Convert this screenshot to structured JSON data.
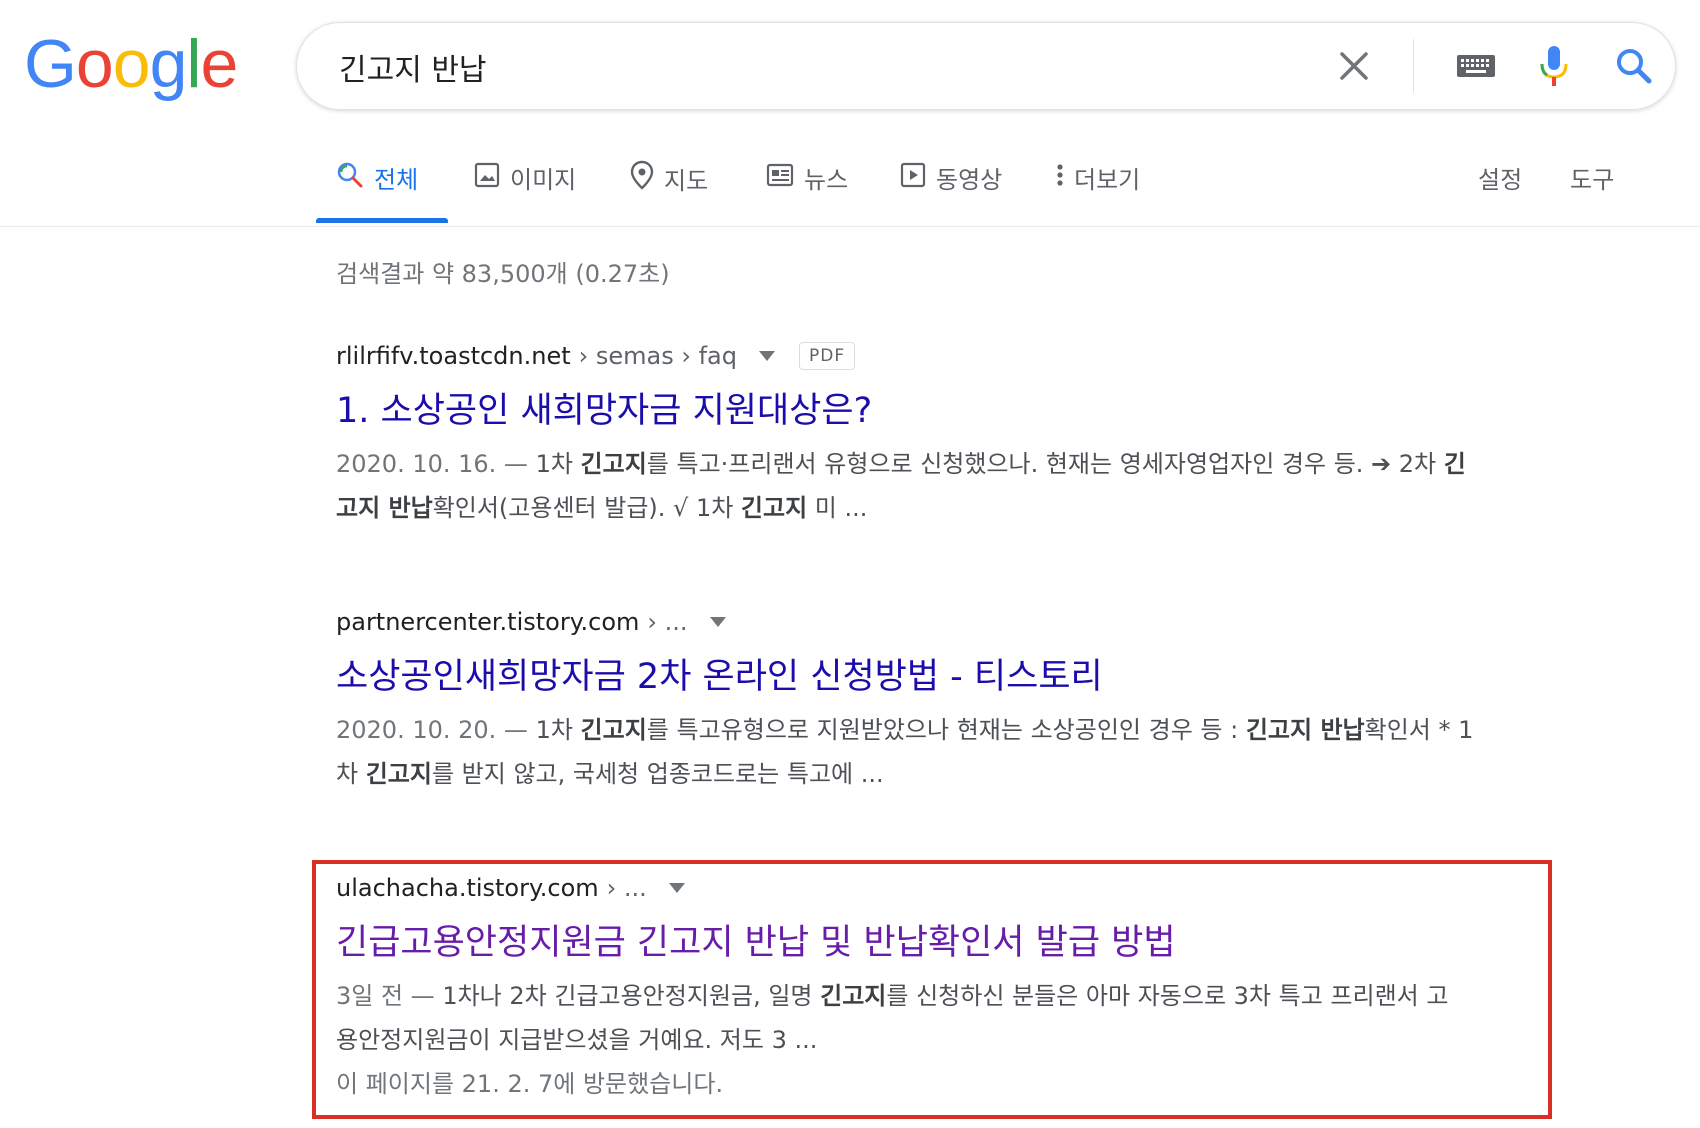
{
  "logo": {
    "letters": [
      "G",
      "o",
      "o",
      "g",
      "l",
      "e"
    ],
    "colors": [
      "#4285F4",
      "#EA4335",
      "#FBBC05",
      "#4285F4",
      "#34A853",
      "#EA4335"
    ]
  },
  "search": {
    "query": "긴고지 반납"
  },
  "icons": {
    "clear": "close-icon",
    "keyboard": "keyboard-icon",
    "voice": "microphone-icon",
    "search": "search-icon"
  },
  "tabs": [
    {
      "label": "전체",
      "icon": "search-icon",
      "active": true
    },
    {
      "label": "이미지",
      "icon": "image-icon"
    },
    {
      "label": "지도",
      "icon": "map-pin-icon"
    },
    {
      "label": "뉴스",
      "icon": "news-icon"
    },
    {
      "label": "동영상",
      "icon": "video-icon"
    },
    {
      "label": "더보기",
      "icon": "more-vert-icon"
    }
  ],
  "tools": {
    "settings": "설정",
    "tools": "도구"
  },
  "stats": "검색결과 약 83,500개 (0.27초)",
  "colors": {
    "link": "#1a0dab",
    "visited": "#681da8",
    "accent": "#1a73e8",
    "highlight": "#d93025"
  },
  "results": [
    {
      "domain": "rlilrfifv.toastcdn.net",
      "path": " › semas › faq",
      "badge": "PDF",
      "title": "1. 소상공인 새희망자금 지원대상은?",
      "date": "2020. 10. 16. — ",
      "snippet_line1": [
        {
          "t": "1차 "
        },
        {
          "t": "긴고지",
          "b": true
        },
        {
          "t": "를 특고·프리랜서 유형으로 신청했으나. 현재는 영세자영업자인 경우 등. ➔ 2차 "
        },
        {
          "t": "긴",
          "b": true
        }
      ],
      "snippet_line2": [
        {
          "t": "고지 반납",
          "b": true
        },
        {
          "t": "확인서(고용센터 발급). √ 1차 "
        },
        {
          "t": "긴고지",
          "b": true
        },
        {
          "t": " 미 ..."
        }
      ]
    },
    {
      "domain": "partnercenter.tistory.com",
      "path": " › ...",
      "title": "소상공인새희망자금 2차 온라인 신청방법 - 티스토리",
      "date": "2020. 10. 20. — ",
      "snippet_line1": [
        {
          "t": "1차 "
        },
        {
          "t": "긴고지",
          "b": true
        },
        {
          "t": "를 특고유형으로 지원받았으나 현재는 소상공인인 경우 등 : "
        },
        {
          "t": "긴고지 반납",
          "b": true
        },
        {
          "t": "확인서 * 1"
        }
      ],
      "snippet_line2": [
        {
          "t": "차 "
        },
        {
          "t": "긴고지",
          "b": true
        },
        {
          "t": "를 받지 않고, 국세청 업종코드로는 특고에 ..."
        }
      ]
    },
    {
      "domain": "ulachacha.tistory.com",
      "path": " › ...",
      "title": "긴급고용안정지원금 긴고지 반납 및 반납확인서 발급 방법",
      "date": "3일 전 — ",
      "snippet_line1": [
        {
          "t": "1차나 2차 긴급고용안정지원금, 일명 "
        },
        {
          "t": "긴고지",
          "b": true
        },
        {
          "t": "를 신청하신 분들은 아마 자동으로 3차 특고 프리랜서 고"
        }
      ],
      "snippet_line2": [
        {
          "t": "용안정지원금이 지급받으셨을 거예요. 저도 3 ..."
        }
      ],
      "visited_note": "이 페이지를 21. 2. 7에 방문했습니다."
    }
  ]
}
